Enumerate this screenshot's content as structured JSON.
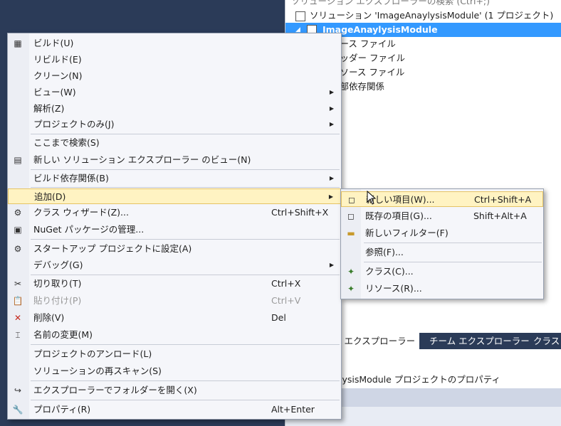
{
  "explorer": {
    "top_partial": "ソリューション エクスプローラーの検索 (Ctrl+;)",
    "solution_row": "ソリューション 'ImageAnaylysisModule' (1 プロジェクト)",
    "project_row": "ImageAnaylysisModule",
    "folders": [
      "ソース ファイル",
      "ヘッダー ファイル",
      "リソース ファイル",
      "外部依存関係"
    ],
    "tabs": [
      "ン エクスプローラー",
      "チーム エクスプローラー",
      "クラス"
    ],
    "properties_title": "lysisModule プロジェクトのプロパティ"
  },
  "main_menu": {
    "items": [
      {
        "label": "ビルド(U)",
        "icon": "build-icon"
      },
      {
        "label": "リビルド(E)"
      },
      {
        "label": "クリーン(N)"
      },
      {
        "label": "ビュー(W)",
        "submenu": true
      },
      {
        "label": "解析(Z)",
        "submenu": true
      },
      {
        "label": "プロジェクトのみ(J)",
        "submenu": true
      },
      {
        "label": "ここまで検索(S)"
      },
      {
        "label": "新しい ソリューション エクスプローラー のビュー(N)",
        "icon": "new-view-icon"
      },
      {
        "label": "ビルド依存関係(B)",
        "submenu": true
      },
      {
        "label": "追加(D)",
        "submenu": true,
        "highlighted": true
      },
      {
        "label": "クラス ウィザード(Z)...",
        "shortcut": "Ctrl+Shift+X",
        "icon": "class-wizard-icon"
      },
      {
        "label": "NuGet パッケージの管理...",
        "icon": "nuget-icon"
      },
      {
        "label": "スタートアップ プロジェクトに設定(A)",
        "icon": "gear-icon"
      },
      {
        "label": "デバッグ(G)",
        "submenu": true
      },
      {
        "label": "切り取り(T)",
        "shortcut": "Ctrl+X",
        "icon": "scissors-icon"
      },
      {
        "label": "貼り付け(P)",
        "shortcut": "Ctrl+V",
        "icon": "paste-icon",
        "disabled": true
      },
      {
        "label": "削除(V)",
        "shortcut": "Del",
        "icon": "delete-icon"
      },
      {
        "label": "名前の変更(M)",
        "icon": "rename-icon"
      },
      {
        "label": "プロジェクトのアンロード(L)"
      },
      {
        "label": "ソリューションの再スキャン(S)"
      },
      {
        "label": "エクスプローラーでフォルダーを開く(X)",
        "icon": "open-folder-arrow-icon"
      },
      {
        "label": "プロパティ(R)",
        "shortcut": "Alt+Enter",
        "icon": "wrench-icon"
      }
    ]
  },
  "sub_menu": {
    "items": [
      {
        "label": "新しい項目(W)...",
        "shortcut": "Ctrl+Shift+A",
        "icon": "new-item-icon",
        "highlighted": true
      },
      {
        "label": "既存の項目(G)...",
        "shortcut": "Shift+Alt+A",
        "icon": "existing-item-icon"
      },
      {
        "label": "新しいフィルター(F)",
        "icon": "new-filter-icon"
      },
      {
        "label": "参照(F)..."
      },
      {
        "label": "クラス(C)...",
        "icon": "class-icon"
      },
      {
        "label": "リソース(R)...",
        "icon": "resource-icon"
      }
    ]
  },
  "colors": {
    "highlight": "#fff3c2",
    "selection": "#3399ff",
    "background": "#2b3b58"
  }
}
